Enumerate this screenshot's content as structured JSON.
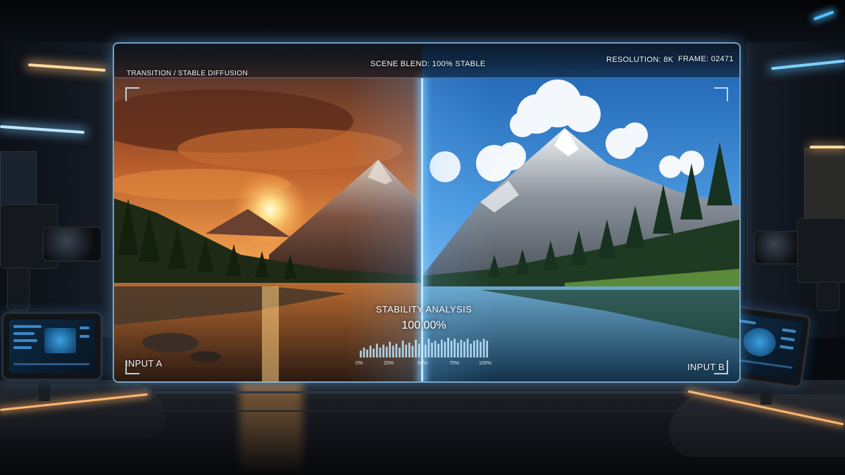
{
  "hud": {
    "top_left": "TRANSITION / STABLE DIFFUSION",
    "top_center": "SCENE BLEND: 100% STABLE",
    "resolution": "RESOLUTION: 8K",
    "frame": "FRAME: 02471",
    "input_a": "INPUT A",
    "input_b": "INPUT B"
  },
  "stability": {
    "title": "STABILITY ANALYSIS",
    "value": "100.00%",
    "ticks": [
      "0%",
      "25%",
      "50%",
      "75%",
      "100%"
    ],
    "bar_levels": [
      0.35,
      0.5,
      0.4,
      0.6,
      0.45,
      0.7,
      0.5,
      0.65,
      0.55,
      0.8,
      0.6,
      0.7,
      0.5,
      0.85,
      0.65,
      0.75,
      0.6,
      0.9,
      0.7,
      0.8,
      0.65,
      0.95,
      0.75,
      0.85,
      0.7,
      0.9,
      0.8,
      1.0,
      0.85,
      0.95,
      0.75,
      0.9,
      0.8,
      0.95,
      0.7,
      0.85,
      0.9,
      0.8,
      0.95,
      0.85
    ]
  },
  "colors": {
    "accent": "#bfe8ff",
    "sunset": "#ff9a3c",
    "sky_day": "#3f8fd8"
  }
}
